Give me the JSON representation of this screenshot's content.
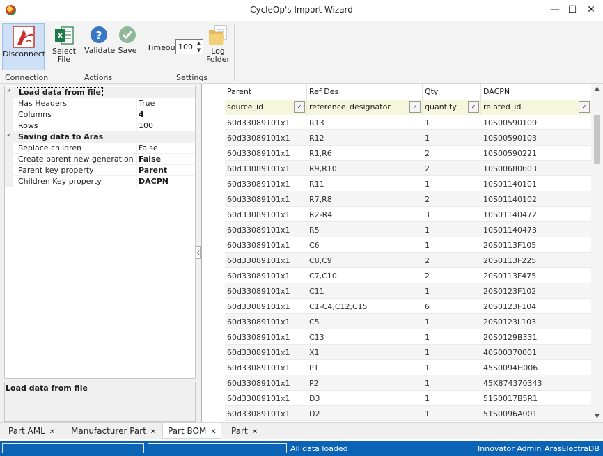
{
  "window": {
    "title": "CycleOp's Import Wizard"
  },
  "ribbon": {
    "connection": {
      "disconnect_label": "Disconnect",
      "group_label": "Connection"
    },
    "actions": {
      "select_file_label": "Select File",
      "validate_label": "Validate",
      "save_label": "Save",
      "group_label": "Actions"
    },
    "settings": {
      "timeout_label": "Timeout",
      "timeout_value": "100",
      "log_folder_label": "Log Folder",
      "group_label": "Settings"
    }
  },
  "properties": {
    "load": {
      "category": "Load data from file",
      "rows": [
        {
          "name": "Has Headers",
          "value": "True",
          "bold": false
        },
        {
          "name": "Columns",
          "value": "4",
          "bold": true
        },
        {
          "name": "Rows",
          "value": "100",
          "bold": false
        }
      ]
    },
    "save": {
      "category": "Saving data to Aras",
      "rows": [
        {
          "name": "Replace children",
          "value": "False",
          "bold": false
        },
        {
          "name": "Create parent new generation",
          "value": "False",
          "bold": true
        },
        {
          "name": "Parent key property",
          "value": "Parent",
          "bold": true
        },
        {
          "name": "Children Key property",
          "value": "DACPN",
          "bold": true
        }
      ]
    },
    "description_title": "Load data from file"
  },
  "grid": {
    "headers": [
      "Parent",
      "Ref Des",
      "Qty",
      "DACPN"
    ],
    "mappings": [
      "source_id",
      "reference_designator",
      "quantity",
      "related_id"
    ],
    "rows": [
      [
        "60d33089101x1",
        "R13",
        "1",
        "10S00590100"
      ],
      [
        "60d33089101x1",
        "R12",
        "1",
        "10S00590103"
      ],
      [
        "60d33089101x1",
        "R1,R6",
        "2",
        "10S00590221"
      ],
      [
        "60d33089101x1",
        "R9,R10",
        "2",
        "10S00680603"
      ],
      [
        "60d33089101x1",
        "R11",
        "1",
        "10S01140101"
      ],
      [
        "60d33089101x1",
        "R7,R8",
        "2",
        "10S01140102"
      ],
      [
        "60d33089101x1",
        "R2-R4",
        "3",
        "10S01140472"
      ],
      [
        "60d33089101x1",
        "R5",
        "1",
        "10S01140473"
      ],
      [
        "60d33089101x1",
        "C6",
        "1",
        "20S0113F105"
      ],
      [
        "60d33089101x1",
        "C8,C9",
        "2",
        "20S0113F225"
      ],
      [
        "60d33089101x1",
        "C7,C10",
        "2",
        "20S0113F475"
      ],
      [
        "60d33089101x1",
        "C11",
        "1",
        "20S0123F102"
      ],
      [
        "60d33089101x1",
        "C1-C4,C12,C15",
        "6",
        "20S0123F104"
      ],
      [
        "60d33089101x1",
        "C5",
        "1",
        "20S0123L103"
      ],
      [
        "60d33089101x1",
        "C13",
        "1",
        "20S0129B331"
      ],
      [
        "60d33089101x1",
        "X1",
        "1",
        "40S00370001"
      ],
      [
        "60d33089101x1",
        "P1",
        "1",
        "45S0094H006"
      ],
      [
        "60d33089101x1",
        "P2",
        "1",
        "45X874370343"
      ],
      [
        "60d33089101x1",
        "D3",
        "1",
        "51S0017B5R1"
      ],
      [
        "60d33089101x1",
        "D2",
        "1",
        "51S0096A001"
      ]
    ]
  },
  "tabs": [
    "Part AML",
    "Manufacturer Part",
    "Part BOM",
    "Part"
  ],
  "active_tab": "Part BOM",
  "status": {
    "message": "All data loaded",
    "user": "Innovator Admin",
    "database": "ArasElectraDB"
  },
  "colors": {
    "status_bar": "#0a63b5",
    "ribbon_active": "#cde0f5",
    "filter_row": "#f6f6dc"
  },
  "icons": [
    "app-logo-icon",
    "disconnect-icon",
    "excel-icon",
    "validate-icon",
    "save-check-icon",
    "folder-icon",
    "minimize-icon",
    "maximize-icon",
    "close-icon"
  ]
}
